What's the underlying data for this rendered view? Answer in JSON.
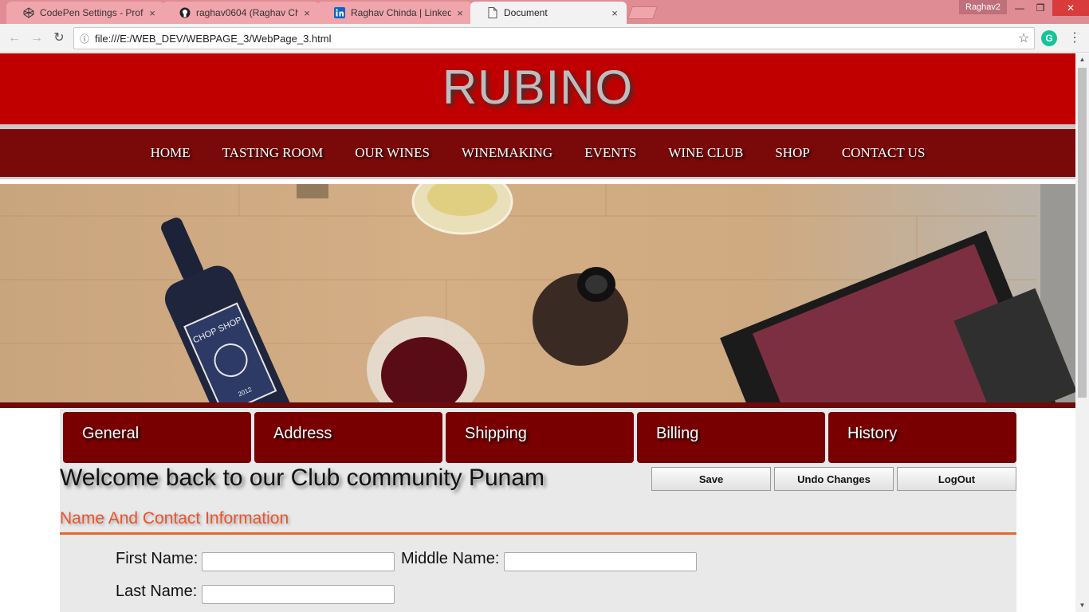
{
  "browser": {
    "tabs": [
      {
        "title": "CodePen Settings - Profil",
        "icon": "codepen-icon",
        "close": "×"
      },
      {
        "title": "raghav0604 (Raghav Chi",
        "icon": "github-icon",
        "close": "×"
      },
      {
        "title": "Raghav Chinda | LinkedIn",
        "icon": "linkedin-icon",
        "close": "×"
      },
      {
        "title": "Document",
        "icon": "document-icon",
        "close": "×"
      }
    ],
    "profile_name": "Raghav2",
    "address": "file:///E:/WEB_DEV/WEBPAGE_3/WebPage_3.html",
    "extension_letter": "G"
  },
  "site": {
    "brand": "RUBINO",
    "nav": [
      "HOME",
      "TASTING ROOM",
      "OUR WINES",
      "WINEMAKING",
      "EVENTS",
      "WINE CLUB",
      "SHOP",
      "CONTACT US"
    ],
    "hero": {
      "bottle_label_line1": "CHOP SHOP",
      "bottle_label_year": "2012"
    }
  },
  "club": {
    "tabs": [
      "General",
      "Address",
      "Shipping",
      "Billing",
      "History"
    ],
    "welcome": "Welcome back to our Club community Punam",
    "buttons": {
      "save": "Save",
      "undo": "Undo Changes",
      "logout": "LogOut"
    },
    "section_title": "Name And Contact Information",
    "fields": {
      "first_name_label": "First Name:",
      "middle_name_label": "Middle Name:",
      "last_name_label": "Last Name:",
      "first_name_value": "",
      "middle_name_value": "",
      "last_name_value": ""
    }
  },
  "colors": {
    "brand_red": "#c00000",
    "nav_maroon": "#7a0a0a",
    "tab_maroon": "#780000",
    "section_orange": "#e8542a"
  }
}
